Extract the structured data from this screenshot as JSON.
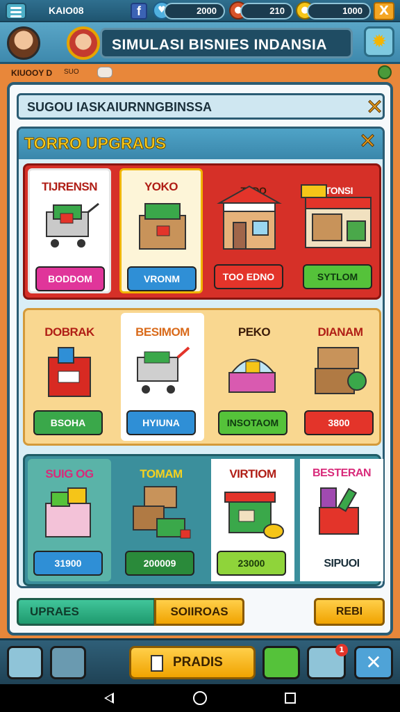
{
  "topbar": {
    "player_name": "KAIO08",
    "fb_label": "f",
    "gems": "2000",
    "tokens": "210",
    "coins": "1000",
    "close_label": "X"
  },
  "header": {
    "title": "SIMULASI BISNIES INDANSIA"
  },
  "subbar": {
    "text": "KIUOOY D",
    "tag": "SUO"
  },
  "search": {
    "text": "SUGOU IASKAIURNNGBINSSA"
  },
  "upgrade": {
    "title": "TORRO UPGRAUS",
    "row1": [
      {
        "label": "TIJRENSN",
        "button": "BODDOM",
        "btn_color": "#e0359a"
      },
      {
        "label": "YOKO",
        "button": "VRONM",
        "btn_color": "#2f8fd6"
      },
      {
        "label": "TSDO",
        "button": "TOO EDNO",
        "btn_color": "#e3342a"
      },
      {
        "label": "TONSI",
        "button": "SYTLOM",
        "btn_color": "#55c23a"
      }
    ],
    "row2": [
      {
        "label": "DOBRAK",
        "button": "BSOHA",
        "btn_color": "#3aa84a"
      },
      {
        "label": "BESIMOM",
        "button": "HYIUNA",
        "btn_color": "#2f8fd6"
      },
      {
        "label": "PEKO",
        "button": "INSOTAOM",
        "btn_color": "#55c23a"
      },
      {
        "label": "DIANAM",
        "button": "3800",
        "btn_color": "#e3342a"
      }
    ],
    "row3": [
      {
        "label": "SUIG OG",
        "button": "31900",
        "btn_color": "#2f8fd6"
      },
      {
        "label": "TOMAM",
        "button": "200009",
        "btn_color": "#2a8a3a"
      },
      {
        "label": "VIRTIOM",
        "button": "23000",
        "btn_color": "#8fd43a"
      },
      {
        "label": "BESTERAN",
        "button": "SIPUOI",
        "btn_color": ""
      }
    ]
  },
  "tabs": {
    "left": "UPRAES",
    "right": "SOIIROAS"
  },
  "rebi_button": "REBI",
  "footer": {
    "center_label": "PRADIS",
    "notif_count": "1"
  }
}
